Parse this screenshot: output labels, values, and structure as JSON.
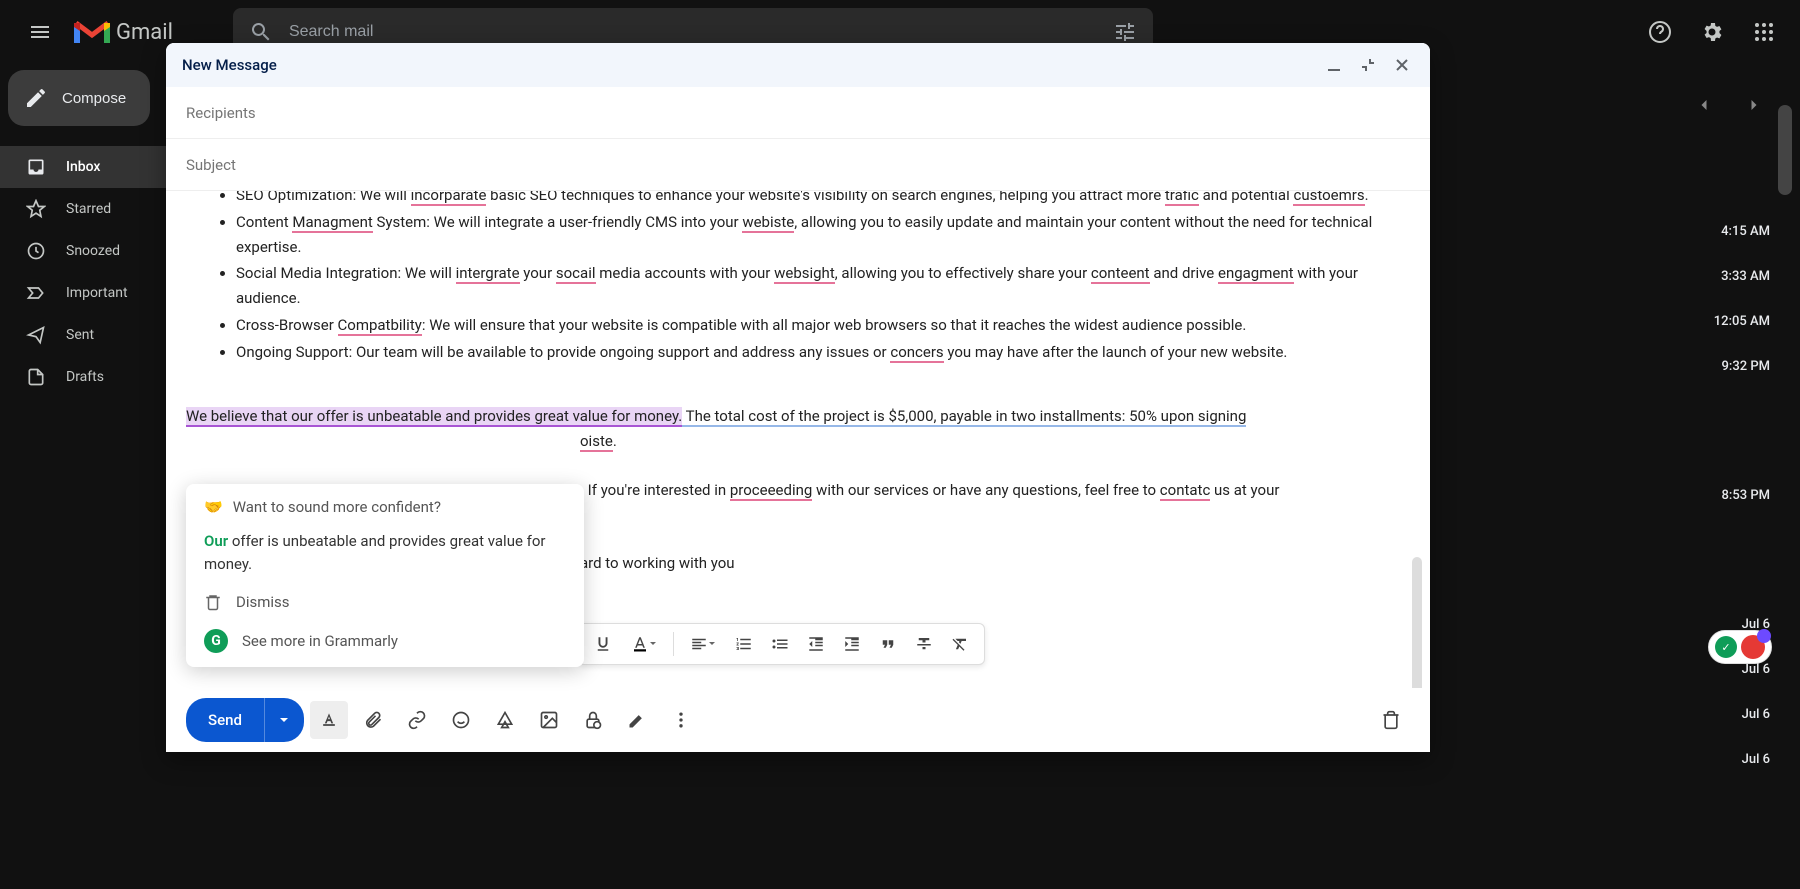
{
  "header": {
    "app_name": "Gmail",
    "search_placeholder": "Search mail"
  },
  "sidebar": {
    "compose": "Compose",
    "items": [
      {
        "label": "Inbox",
        "active": true
      },
      {
        "label": "Starred"
      },
      {
        "label": "Snoozed"
      },
      {
        "label": "Important"
      },
      {
        "label": "Sent"
      },
      {
        "label": "Drafts"
      }
    ]
  },
  "email_times": [
    "4:15 AM",
    "3:33 AM",
    "12:05 AM",
    "9:32 PM",
    "8:53 PM",
    "Jul 6",
    "Jul 6",
    "Jul 6",
    "Jul 6"
  ],
  "compose": {
    "title": "New Message",
    "recipients_placeholder": "Recipients",
    "subject_placeholder": "Subject",
    "send": "Send",
    "body": {
      "li1a": "SEO Optimization: We will ",
      "li1b": "incorparate",
      "li1c": " basic SEO techniques to enhance your website's visibility on search engines, helping you attract more ",
      "li1d": "trafic",
      "li1e": " and potential ",
      "li1f": "custoemrs",
      "li1g": ".",
      "li2a": "Content ",
      "li2b": "Managment",
      "li2c": " System: We will integrate a user-friendly CMS into your ",
      "li2d": "webiste",
      "li2e": ", allowing you to easily update and maintain your content without the need for technical expertise.",
      "li3a": "Social Media Integration: We will ",
      "li3b": "intergrate",
      "li3c": " your ",
      "li3d": "socail",
      "li3e": " media accounts with your ",
      "li3f": "websight",
      "li3g": ", allowing you to effectively share your ",
      "li3h": "conteent",
      "li3i": " and drive ",
      "li3j": "engagment",
      "li3k": " with your audience.",
      "li4a": "Cross-Browser ",
      "li4b": "Compatbility",
      "li4c": ": We will ensure that your website is compatible with all major web browsers so that it reaches the widest audience possible.",
      "li5a": "Ongoing Support: Our team will be available to provide ongoing support and address any issues or ",
      "li5b": "concers",
      "li5c": " you may have after the launch of your new website.",
      "p1a": "We believe that our offer is unbeatable and provides great value for money.",
      "p1b": " The total cost of the project is $5,000, payable in two installments: 50% upon signing",
      "p1c": "oiste",
      "p1d": ".",
      "p2a": ". If you're interested in ",
      "p2b": "proceeeding",
      "p2c": " with our services or have any questions, feel free to ",
      "p2d": "contatc",
      "p2e": " us at your",
      "p3": "ard to working with you"
    }
  },
  "grammarly": {
    "header": "Want to sound more confident?",
    "our": "Our",
    "suggestion": " offer is unbeatable and provides great value for money.",
    "dismiss": "Dismiss",
    "more": "See more in Grammarly"
  }
}
